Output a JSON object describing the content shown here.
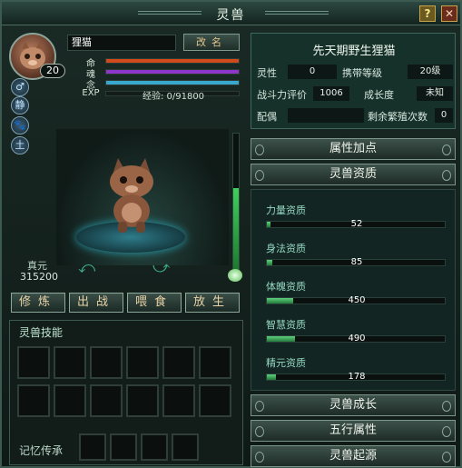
{
  "window": {
    "title": "灵兽",
    "help_label": "?",
    "close_label": "✕"
  },
  "pet": {
    "name": "狸猫",
    "level": "20",
    "rename_label": "改名",
    "bars": [
      {
        "label": "命",
        "color": "#d24a1c"
      },
      {
        "label": "魂",
        "color": "#8d36c9"
      },
      {
        "label": "念",
        "color": "#39a8cf"
      },
      {
        "label": "EXP",
        "color": "#b9c7c0"
      }
    ],
    "exp_text": "经验: 0/91800",
    "side_icons": [
      {
        "label": "♂",
        "name": "gender-male-icon"
      },
      {
        "label": "静",
        "name": "calm-icon"
      },
      {
        "label": "🐾",
        "name": "paw-icon"
      },
      {
        "label": "土",
        "name": "earth-element-icon"
      }
    ],
    "zhenyuan_label": "真元",
    "zhenyuan_value": "315200"
  },
  "actions": [
    {
      "label": "修炼",
      "name": "cultivate-button"
    },
    {
      "label": "出战",
      "name": "battle-button"
    },
    {
      "label": "喂食",
      "name": "feed-button"
    },
    {
      "label": "放生",
      "name": "release-button"
    }
  ],
  "skills": {
    "title": "灵兽技能",
    "memory_label": "记忆传承"
  },
  "info": {
    "title": "先天期野生狸猫",
    "rows": [
      [
        {
          "label": "灵性",
          "value": "0"
        },
        {
          "label": "携带等级",
          "value": "20级"
        }
      ],
      [
        {
          "label": "战斗力评价",
          "value": "1006"
        },
        {
          "label": "成长度",
          "value": "未知"
        }
      ],
      [
        {
          "label": "配偶",
          "value": ""
        },
        {
          "label": "剩余繁殖次数",
          "value": "0"
        }
      ]
    ]
  },
  "sections": {
    "attributes": "属性加点",
    "aptitude": "灵兽资质",
    "growth": "灵兽成长",
    "five_elements": "五行属性",
    "origin": "灵兽起源"
  },
  "aptitudes": [
    {
      "label": "力量资质",
      "value": "52",
      "fill": 0.02
    },
    {
      "label": "身法资质",
      "value": "85",
      "fill": 0.03
    },
    {
      "label": "体魄资质",
      "value": "450",
      "fill": 0.15
    },
    {
      "label": "智慧资质",
      "value": "490",
      "fill": 0.16
    },
    {
      "label": "精元资质",
      "value": "178",
      "fill": 0.05
    }
  ]
}
